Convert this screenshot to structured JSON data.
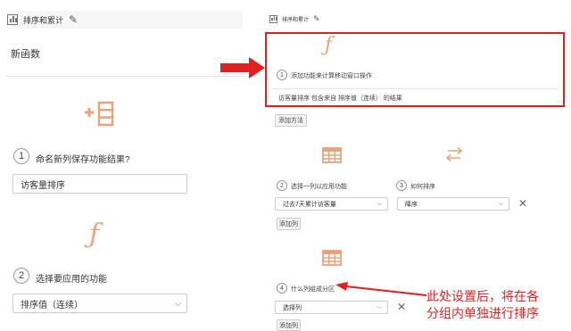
{
  "left": {
    "header_title": "排序和累计",
    "section_title": "新函数",
    "step1": {
      "num": "1",
      "label": "命名新列保存功能结果?",
      "value": "访客量排序"
    },
    "step2": {
      "num": "2",
      "label": "选择要应用的功能",
      "value": "排序值（连续）"
    }
  },
  "right": {
    "header_title": "排序和累计",
    "function_row": {
      "num": "1",
      "label": "添加功能来计算移动窗口操作"
    },
    "summary": "访客量排序 包含来自 排序值（连续） 的结果",
    "add_function_btn": "添加方法",
    "step2": {
      "num": "2",
      "label": "选择一列以应用功能",
      "value": "过去7天累计访客量"
    },
    "step3": {
      "num": "3",
      "label": "如何排序",
      "value": "降序"
    },
    "add_column_btn_1": "添加列",
    "step4": {
      "num": "4",
      "label": "什么列组成分区",
      "value": "选择列"
    },
    "add_column_btn_2": "添加列"
  },
  "annotation": {
    "callout_lines": [
      "此处设置后，将在各",
      "分组内单独进行排序"
    ],
    "colors": {
      "red": "#e02020",
      "orange": "#e9a37c"
    }
  }
}
